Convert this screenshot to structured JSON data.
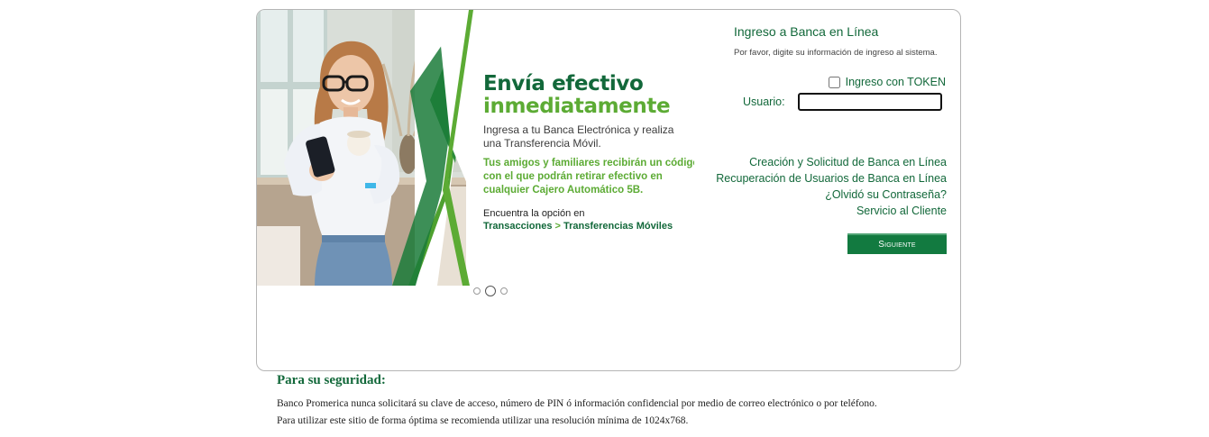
{
  "banner": {
    "headline_1": "Envía efectivo",
    "headline_2": "inmediatamente",
    "intro": "Ingresa a tu Banca Electrónica y realiza una Transferencia Móvil.",
    "highlight": "Tus amigos y familiares recibirán un código con el que podrán retirar efectivo en cualquier Cajero Automático 5B.",
    "find_option": "Encuentra la opción en",
    "path_start": "Transacciones",
    "path_separator": ">",
    "path_end": "Transferencias Móviles",
    "carousel": {
      "slides": 3,
      "active_index": 1
    }
  },
  "login": {
    "title": "Ingreso a Banca en Línea",
    "subtitle": "Por favor, digite su información de ingreso al sistema.",
    "token_label": "Ingreso con TOKEN",
    "token_checked": false,
    "username_label": "Usuario:",
    "username_value": "",
    "links": [
      "Creación y Solicitud de Banca en Línea",
      "Recuperación de Usuarios de Banca en Línea",
      "¿Olvidó su Contraseña?",
      "Servicio al Cliente"
    ],
    "next_button": "Siguiente"
  },
  "security": {
    "title": "Para su seguridad:",
    "line_1": "Banco Promerica nunca solicitará su clave de acceso, número de PIN ó información confidencial por medio de correo electrónico o por teléfono.",
    "line_2": "Para utilizar este sitio de forma óptima se recomienda utilizar una resolución mínima de 1024x768."
  },
  "colors": {
    "brand_green": "#12683a",
    "accent_green": "#5cab34",
    "button_green": "#127a40"
  }
}
